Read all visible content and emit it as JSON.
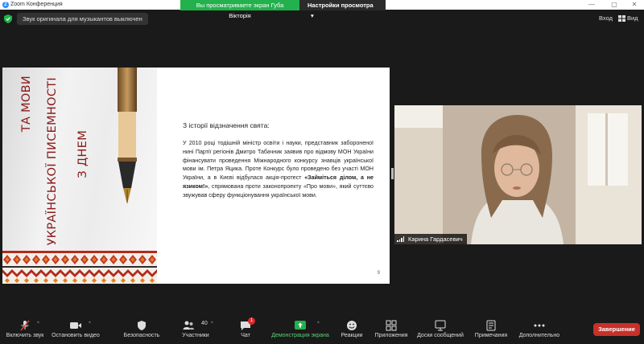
{
  "window": {
    "title": "Zoom Конференция",
    "logo_letter": "Z",
    "minimize": "—",
    "maximize": "▢",
    "close": "✕"
  },
  "share_banner": {
    "message": "Вы просматриваете экран Губа Вікторія",
    "options_label": "Настройки просмотра",
    "options_caret": "▾"
  },
  "notice": {
    "text": "Звук оригинала для музыкантов выключен"
  },
  "top_right": {
    "sign_in": "Вход",
    "view": "Вид"
  },
  "slide": {
    "title_lines": [
      "З ДНЕМ",
      "УКРАЇНСЬКОЇ ПИСЕМНОСТІ",
      "ТА МОВИ"
    ],
    "heading": "З історії відзначення свята:",
    "body_part1": "У 2010 році тодішній міністр освіти і науки, представник забороненої нині Партії регіонів Дмитро Табачник заявив про відмову МОН України фінансувати проведення Міжнародного конкурсу знавців української мови ім. Петра Яцика. Проте Конкурс було проведено без участі МОН України, а в Києві відбулася акція-протест ",
    "body_bold": "«Займіться ділом, а не язиком!»",
    "body_part2": ", спрямована проти законопроекту «Про мови», який суттєво звужував сферу функціонування української мови.",
    "page_number": "9"
  },
  "participant": {
    "name": "Карина Гардасевич"
  },
  "toolbar": {
    "items": [
      {
        "label": "Включить звук"
      },
      {
        "label": "Остановить видео"
      },
      {
        "label": "Безопасность"
      },
      {
        "label": "Участники",
        "count": "40"
      },
      {
        "label": "Чат",
        "badge": "1"
      },
      {
        "label": "Демонстрация экрана"
      },
      {
        "label": "Реакции"
      },
      {
        "label": "Приложения"
      },
      {
        "label": "Доски сообщений"
      },
      {
        "label": "Примечания"
      },
      {
        "label": "Дополнительно"
      }
    ],
    "caret": "^",
    "end_label": "Завершение"
  },
  "colors": {
    "accent_green": "#22b14c",
    "end_red": "#c8302a",
    "slide_title": "#8b1a1a",
    "zoom_blue": "#2d8cff"
  }
}
